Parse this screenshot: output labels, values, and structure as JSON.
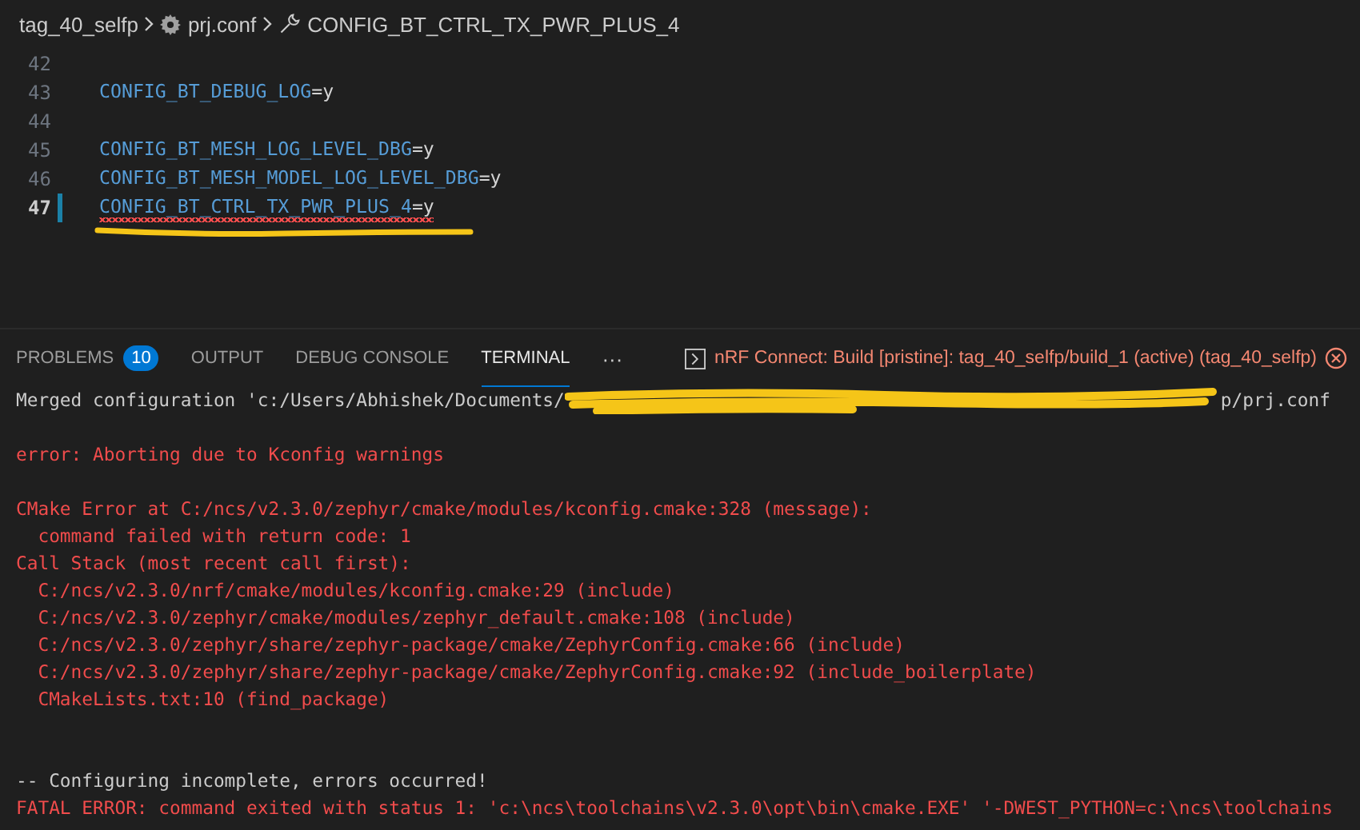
{
  "breadcrumb": {
    "folder": "tag_40_selfp",
    "file": "prj.conf",
    "symbol": "CONFIG_BT_CTRL_TX_PWR_PLUS_4"
  },
  "editor": {
    "lines": [
      {
        "number": "42",
        "current": false
      },
      {
        "number": "43",
        "key": "CONFIG_BT_DEBUG_LOG",
        "value": "=y",
        "current": false,
        "squiggle": false
      },
      {
        "number": "44",
        "current": false
      },
      {
        "number": "45",
        "key": "CONFIG_BT_MESH_LOG_LEVEL_DBG",
        "value": "=y",
        "current": false,
        "squiggle": false
      },
      {
        "number": "46",
        "key": "CONFIG_BT_MESH_MODEL_LOG_LEVEL_DBG",
        "value": "=y",
        "current": false,
        "squiggle": false
      },
      {
        "number": "47",
        "key": "CONFIG_BT_CTRL_TX_PWR_PLUS_4",
        "value": "=y",
        "current": true,
        "squiggle": true
      }
    ]
  },
  "panel": {
    "tabs": [
      {
        "label": "PROBLEMS",
        "badge": "10",
        "selected": false
      },
      {
        "label": "OUTPUT",
        "selected": false
      },
      {
        "label": "DEBUG CONSOLE",
        "selected": false
      },
      {
        "label": "TERMINAL",
        "selected": true
      }
    ],
    "more": "···",
    "terminal_title": "nRF Connect: Build [pristine]: tag_40_selfp/build_1 (active) (tag_40_selfp)",
    "blocks": [
      [
        {
          "kind": "redacted",
          "text": "Merged configuration 'c:/Users/Abhishek/Documents/",
          "tail": "p/prj.conf"
        }
      ],
      [
        {
          "kind": "error",
          "text": "error: Aborting due to Kconfig warnings"
        }
      ],
      [
        {
          "kind": "error",
          "text": "CMake Error at C:/ncs/v2.3.0/zephyr/cmake/modules/kconfig.cmake:328 (message):"
        },
        {
          "kind": "error",
          "text": "  command failed with return code: 1"
        },
        {
          "kind": "error",
          "text": "Call Stack (most recent call first):"
        },
        {
          "kind": "error",
          "text": "  C:/ncs/v2.3.0/nrf/cmake/modules/kconfig.cmake:29 (include)"
        },
        {
          "kind": "error",
          "text": "  C:/ncs/v2.3.0/zephyr/cmake/modules/zephyr_default.cmake:108 (include)"
        },
        {
          "kind": "error",
          "text": "  C:/ncs/v2.3.0/zephyr/share/zephyr-package/cmake/ZephyrConfig.cmake:66 (include)"
        },
        {
          "kind": "error",
          "text": "  C:/ncs/v2.3.0/zephyr/share/zephyr-package/cmake/ZephyrConfig.cmake:92 (include_boilerplate)"
        },
        {
          "kind": "error",
          "text": "  CMakeLists.txt:10 (find_package)"
        }
      ],
      [
        {
          "kind": "normal",
          "text": "-- Configuring incomplete, errors occurred!"
        },
        {
          "kind": "error",
          "text": "FATAL ERROR: command exited with status 1: 'c:\\ncs\\toolchains\\v2.3.0\\opt\\bin\\cmake.EXE' '-DWEST_PYTHON=c:\\ncs\\toolchains"
        }
      ]
    ]
  }
}
